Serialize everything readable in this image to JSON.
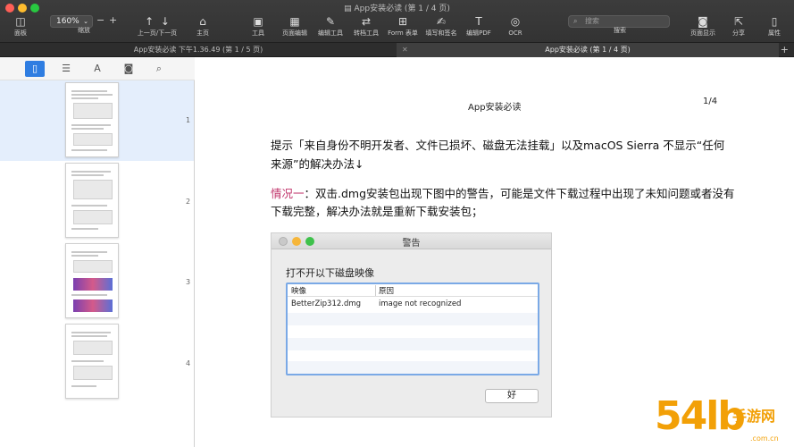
{
  "window": {
    "title": "App安装必读 (第 1 / 4 页)"
  },
  "toolbar": {
    "panel_label": "面板",
    "zoom_value": "160%",
    "zoom_minus": "−",
    "zoom_plus": "+",
    "zoom_label": "缩放",
    "prevnext_label": "上一页/下一页",
    "home_label": "主页",
    "tools_label": "工具",
    "page_edit_label": "页面编辑",
    "edit_tools_label": "编辑工具",
    "convert_label": "转档工具",
    "form_label": "Form 表单",
    "sign_label": "填写和签名",
    "editpdf_label": "编辑PDF",
    "ocr_label": "OCR",
    "search_placeholder": "搜索",
    "search_label": "搜索",
    "page_display_label": "页面显示",
    "share_label": "分享",
    "props_label": "属性"
  },
  "tabs": [
    {
      "label": "App安装必读 下午1.36.49 (第 1 / 5 页)",
      "active": false
    },
    {
      "label": "App安装必读 (第 1 / 4 页)",
      "active": true
    }
  ],
  "sidebar": {
    "tools": [
      "thumbnail",
      "outline",
      "annotation",
      "image",
      "search"
    ],
    "pages": [
      "1",
      "2",
      "3",
      "4"
    ]
  },
  "document": {
    "header": "App安装必读",
    "page_number": "1/4",
    "heading": "提示「来自身份不明开发者、文件已损坏、磁盘无法挂载」以及macOS Sierra 不显示“任何来源”的解决办法↓",
    "case_label": "情况一",
    "case_text": "：双击.dmg安装包出现下图中的警告，可能是文件下载过程中出现了未知问题或者没有下载完整，解决办法就是重新下载安装包；"
  },
  "dialog": {
    "title": "警告",
    "heading": "打不开以下磁盘映像",
    "col_image": "映像",
    "col_reason": "原因",
    "rows": [
      {
        "image": "BetterZip312.dmg",
        "reason": "image not recognized"
      }
    ],
    "ok_label": "好"
  },
  "watermark": {
    "text": "54lb",
    "cn": "手游网",
    "url": ".com.cn"
  },
  "colors": {
    "accent": "#2f7de1",
    "highlight": "#c0336a",
    "watermark": "#f2a007"
  }
}
